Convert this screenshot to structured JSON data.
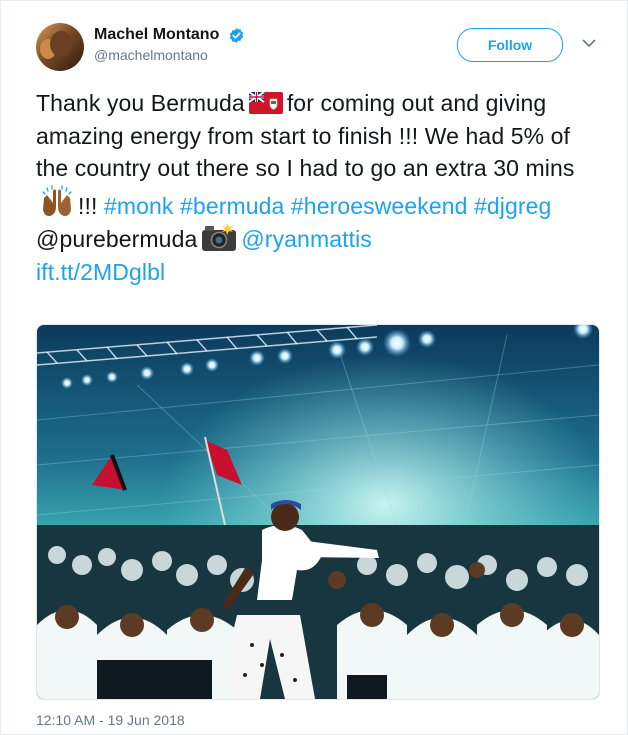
{
  "author": {
    "display_name": "Machel Montano",
    "handle": "@machelmontano",
    "verified": true
  },
  "follow_button": {
    "label": "Follow"
  },
  "tweet": {
    "line_segments": {
      "p1": "Thank you Bermuda",
      "p2": "for coming out and giving amazing energy from start to finish !!! We had 5% of the country out there so I had to go an extra 30 mins",
      "p3": "!!!",
      "hashtag_monk": "#monk",
      "hashtag_bermuda": "#bermuda",
      "hashtag_heroesweekend": "#heroesweekend",
      "hashtag_djgreg": "#djgreg",
      "mention_purebermuda": "@purebermuda",
      "mention_ryanmattis": "@ryanmattis",
      "link": "ift.tt/2MDglbl"
    },
    "emojis": [
      "bermuda-flag",
      "raised-hands",
      "camera-with-flash"
    ]
  },
  "timestamp": "12:10 AM - 19 Jun 2018",
  "colors": {
    "link": "#1da1f2",
    "text": "#14171a",
    "secondary": "#657786",
    "border": "#e6ecf0"
  }
}
